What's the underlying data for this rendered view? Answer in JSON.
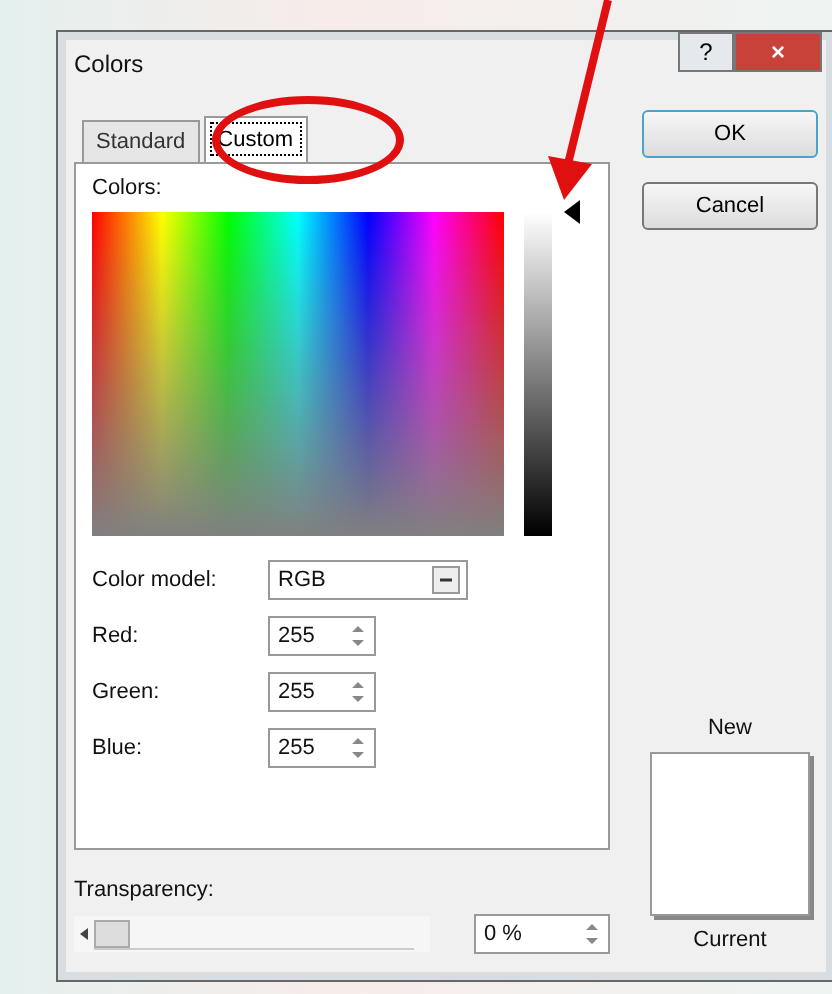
{
  "window": {
    "title": "Colors",
    "help": "?",
    "close": "×"
  },
  "tabs": [
    {
      "label": "Standard",
      "selected": false
    },
    {
      "label": "Custom",
      "selected": true
    }
  ],
  "colors_label": "Colors:",
  "luminance": {
    "level": 1
  },
  "color_model": {
    "label": "Color model:",
    "value": "RGB"
  },
  "channels": [
    {
      "label": "Red:",
      "value": "255"
    },
    {
      "label": "Green:",
      "value": "255"
    },
    {
      "label": "Blue:",
      "value": "255"
    }
  ],
  "transparency": {
    "label": "Transparency:",
    "level": 0,
    "value": "0 %"
  },
  "buttons": [
    "OK",
    "Cancel"
  ],
  "preview": {
    "new_label": "New",
    "current_label": "Current"
  }
}
